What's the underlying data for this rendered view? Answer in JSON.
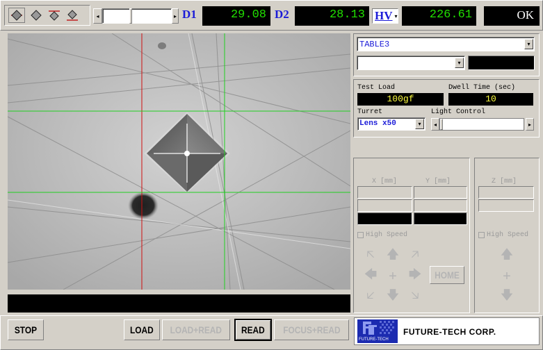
{
  "toolbar": {
    "d1_label": "D1",
    "d1_value": "29.08",
    "d2_label": "D2",
    "d2_value": "28.13",
    "hv_label": "HV",
    "hv_value": "226.61",
    "result": "OK"
  },
  "table": {
    "selected": "TABLE3"
  },
  "test": {
    "load_label": "Test Load",
    "load_value": "100gf",
    "dwell_label": "Dwell Time (sec)",
    "dwell_value": "10",
    "turret_label": "Turret",
    "turret_value": "Lens x50",
    "light_label": "Light Control"
  },
  "stage": {
    "x_label": "X [mm]",
    "y_label": "Y [mm]",
    "z_label": "Z [mm]",
    "high_speed_label": "High Speed",
    "home_label": "HOME"
  },
  "buttons": {
    "stop": "STOP",
    "load": "LOAD",
    "load_read": "LOAD+READ",
    "read": "READ",
    "focus_read": "FOCUS+READ"
  },
  "brand": {
    "name": "FUTURE-TECH CORP.",
    "logo_text": "FUTURE-TECH"
  },
  "colors": {
    "lcd_text": "#21e000",
    "label_blue": "#1b1bd8",
    "lcd_yellow": "#ffff40",
    "crosshair_red": "#d01010",
    "crosshair_green": "#20d020"
  }
}
